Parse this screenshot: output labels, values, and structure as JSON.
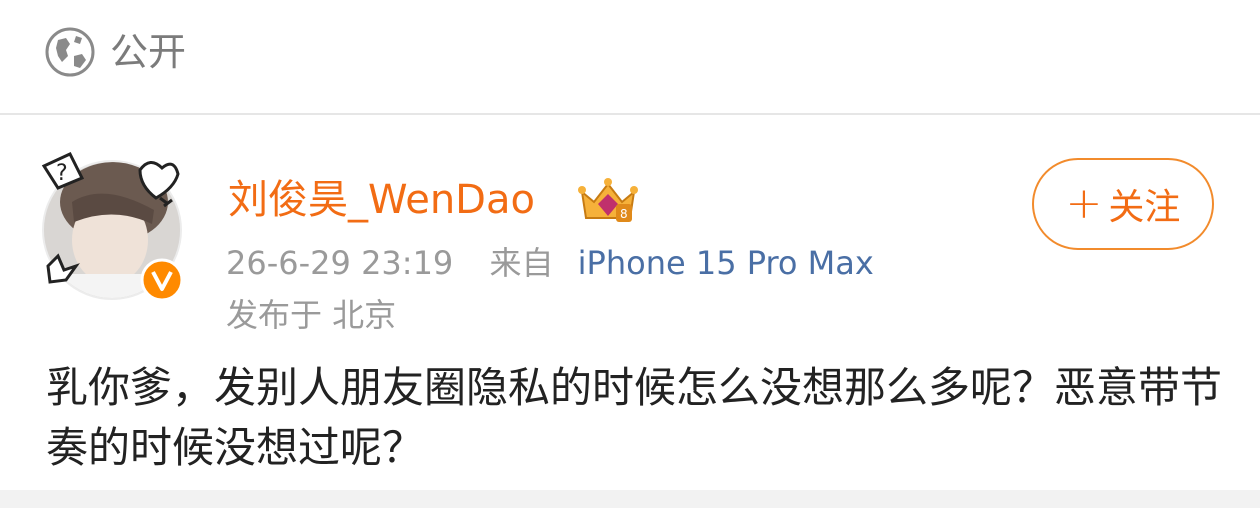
{
  "visibility": {
    "icon": "globe-icon",
    "label": "公开"
  },
  "post": {
    "author": {
      "name": "刘俊昊_WenDao",
      "verified": true,
      "badge_icon": "crown-badge-icon"
    },
    "meta": {
      "time": "26-6-29 23:19",
      "source_prefix": "来自",
      "device": "iPhone 15 Pro Max",
      "location": "发布于 北京"
    },
    "follow": {
      "plus": "+",
      "label": "关注"
    },
    "text": "乳你爹，发别人朋友圈隐私的时候怎么没想那么多呢？恶意带节奏的时候没想过呢？"
  },
  "colors": {
    "accent": "#f26c14",
    "link": "#4a6fa5",
    "muted": "#9a9a9a"
  }
}
